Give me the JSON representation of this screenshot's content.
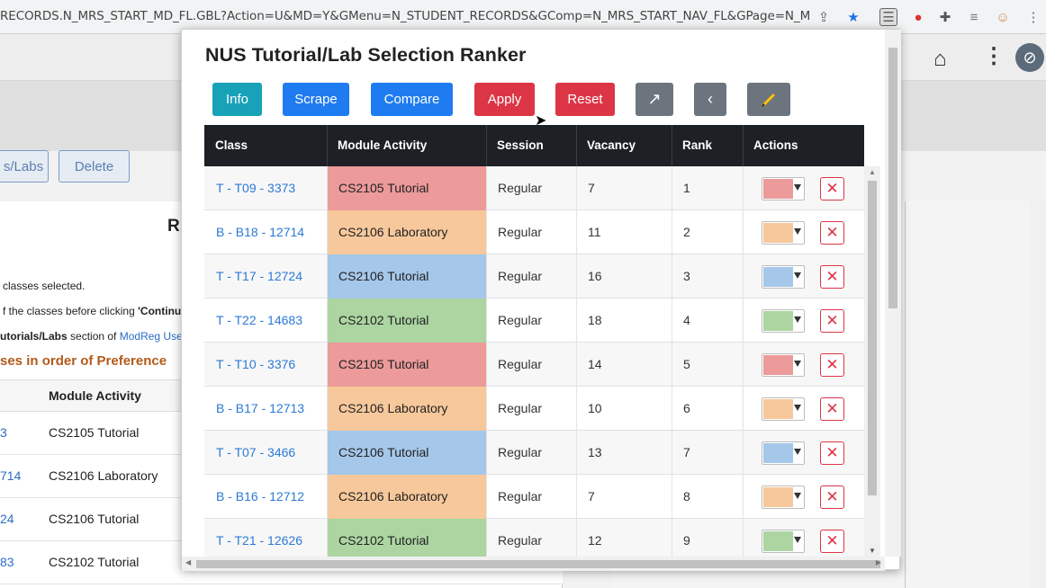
{
  "browser": {
    "url": "RECORDS.N_MRS_START_MD_FL.GBL?Action=U&MD=Y&GMenu=N_STUDENT_RECORDS&GComp=N_MRS_START_NAV_FL&GPage=N_MRS_ST..."
  },
  "background": {
    "buttons": [
      "s/Labs",
      "Delete"
    ],
    "panel_letter": "R",
    "lines": [
      "classes selected.",
      "f the classes before clicking ",
      "'Continue",
      "utorials/Labs",
      " section of ",
      "ModReg User"
    ],
    "heading": "ses in order of Preference",
    "table_header": "Module Activity",
    "rows": [
      {
        "code": "3",
        "activity": "CS2105 Tutorial"
      },
      {
        "code": "714",
        "activity": "CS2106 Laboratory"
      },
      {
        "code": "24",
        "activity": "CS2106 Tutorial"
      },
      {
        "code": "83",
        "activity": "CS2102 Tutorial"
      }
    ]
  },
  "popup": {
    "title": "NUS Tutorial/Lab Selection Ranker",
    "buttons": {
      "info": "Info",
      "scrape": "Scrape",
      "compare": "Compare",
      "apply": "Apply",
      "reset": "Reset"
    },
    "columns": [
      "Class",
      "Module Activity",
      "Session",
      "Vacancy",
      "Rank",
      "Actions"
    ],
    "rows": [
      {
        "cls": "T - T09 - 3373",
        "activity": "CS2105 Tutorial",
        "session": "Regular",
        "vacancy": "7",
        "rank": "1",
        "color": "#ec9a9a"
      },
      {
        "cls": "B - B18 - 12714",
        "activity": "CS2106 Laboratory",
        "session": "Regular",
        "vacancy": "11",
        "rank": "2",
        "color": "#f7c89b"
      },
      {
        "cls": "T - T17 - 12724",
        "activity": "CS2106 Tutorial",
        "session": "Regular",
        "vacancy": "16",
        "rank": "3",
        "color": "#a5c7ea"
      },
      {
        "cls": "T - T22 - 14683",
        "activity": "CS2102 Tutorial",
        "session": "Regular",
        "vacancy": "18",
        "rank": "4",
        "color": "#acd5a1"
      },
      {
        "cls": "T - T10 - 3376",
        "activity": "CS2105 Tutorial",
        "session": "Regular",
        "vacancy": "14",
        "rank": "5",
        "color": "#ec9a9a"
      },
      {
        "cls": "B - B17 - 12713",
        "activity": "CS2106 Laboratory",
        "session": "Regular",
        "vacancy": "10",
        "rank": "6",
        "color": "#f7c89b"
      },
      {
        "cls": "T - T07 - 3466",
        "activity": "CS2106 Tutorial",
        "session": "Regular",
        "vacancy": "13",
        "rank": "7",
        "color": "#a5c7ea"
      },
      {
        "cls": "B - B16 - 12712",
        "activity": "CS2106 Laboratory",
        "session": "Regular",
        "vacancy": "7",
        "rank": "8",
        "color": "#f7c89b"
      },
      {
        "cls": "T - T21 - 12626",
        "activity": "CS2102 Tutorial",
        "session": "Regular",
        "vacancy": "12",
        "rank": "9",
        "color": "#acd5a1"
      }
    ]
  }
}
